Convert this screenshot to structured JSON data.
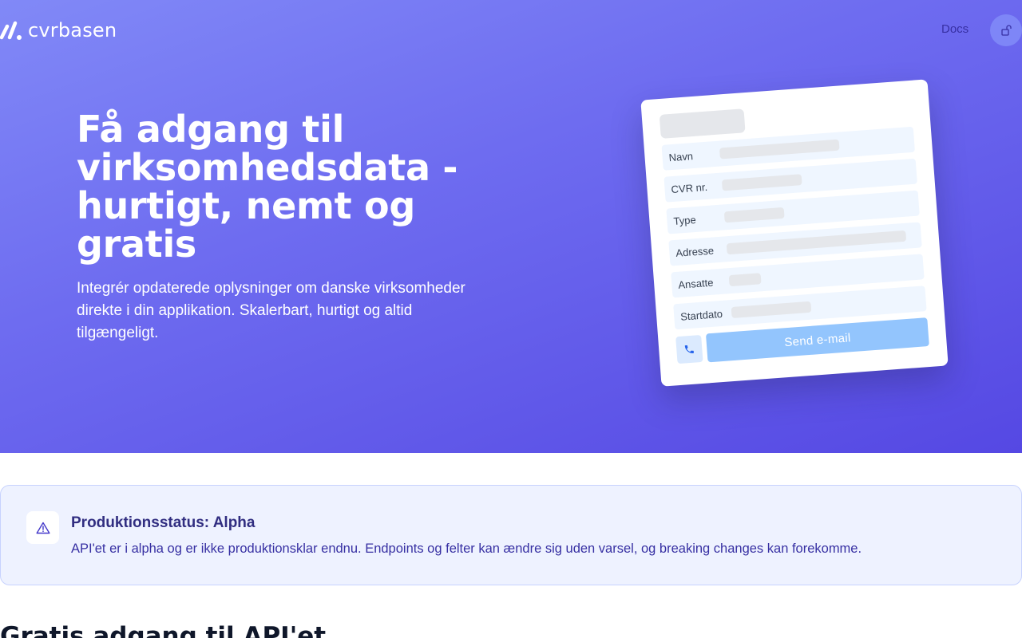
{
  "header": {
    "logo_text": "cvrbasen",
    "nav_docs": "Docs",
    "login_icon": "lock-open-icon"
  },
  "hero": {
    "title": "Få adgang til virksomhedsdata - hurtigt, nemt og gratis",
    "subtitle": "Integrér opdaterede oplysninger om danske virksomheder direkte i din applikation. Skalerbart, hurtigt og altid tilgængeligt."
  },
  "card": {
    "fields": [
      {
        "label": "Navn"
      },
      {
        "label": "CVR nr."
      },
      {
        "label": "Type"
      },
      {
        "label": "Adresse"
      },
      {
        "label": "Ansatte"
      },
      {
        "label": "Startdato"
      }
    ],
    "phone_icon": "phone-icon",
    "send_label": "Send e-mail"
  },
  "alert": {
    "icon": "warning-icon",
    "title": "Produktionsstatus: Alpha",
    "text": "API'et er i alpha og er ikke produktionsklar endnu. Endpoints og felter kan ændre sig uden varsel, og breaking changes kan forekomme."
  },
  "section": {
    "title": "Gratis adgang til API'et"
  },
  "colors": {
    "hero_start": "#8189f7",
    "hero_end": "#5548e3",
    "alert_bg": "#eef2ff",
    "send_button": "#93c5fd"
  }
}
